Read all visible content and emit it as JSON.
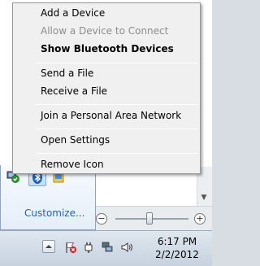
{
  "context_menu": {
    "items": [
      {
        "label": "Add a Device",
        "enabled": true,
        "default": false
      },
      {
        "label": "Allow a Device to Connect",
        "enabled": false,
        "default": false
      },
      {
        "label": "Show Bluetooth Devices",
        "enabled": true,
        "default": true
      },
      {
        "label": "Send a File",
        "enabled": true,
        "default": false
      },
      {
        "label": "Receive a File",
        "enabled": true,
        "default": false
      },
      {
        "label": "Join a Personal Area Network",
        "enabled": true,
        "default": false
      },
      {
        "label": "Open Settings",
        "enabled": true,
        "default": false
      },
      {
        "label": "Remove Icon",
        "enabled": true,
        "default": false
      }
    ]
  },
  "notification_overflow": {
    "icons": [
      "network-shield-icon",
      "bluetooth-icon",
      "application-icon"
    ],
    "customize_label": "Customize..."
  },
  "zoom_bar": {
    "minus_label": "−",
    "plus_label": "+"
  },
  "taskbar": {
    "tray_icons": [
      "show-hidden-icons-arrow",
      "action-center-flag-icon",
      "power-plug-icon",
      "network-icon",
      "volume-icon"
    ],
    "clock": {
      "time": "6:17 PM",
      "date": "2/2/2012"
    }
  },
  "colors": {
    "menu_background": "#f0f0f0",
    "menu_border": "#979797",
    "disabled_text": "#8d8d8d",
    "link_blue": "#1f62b3",
    "bluetooth_blue": "#1f5fb0",
    "taskbar_top": "#dfe7f0",
    "taskbar_bottom": "#c7d2de"
  }
}
